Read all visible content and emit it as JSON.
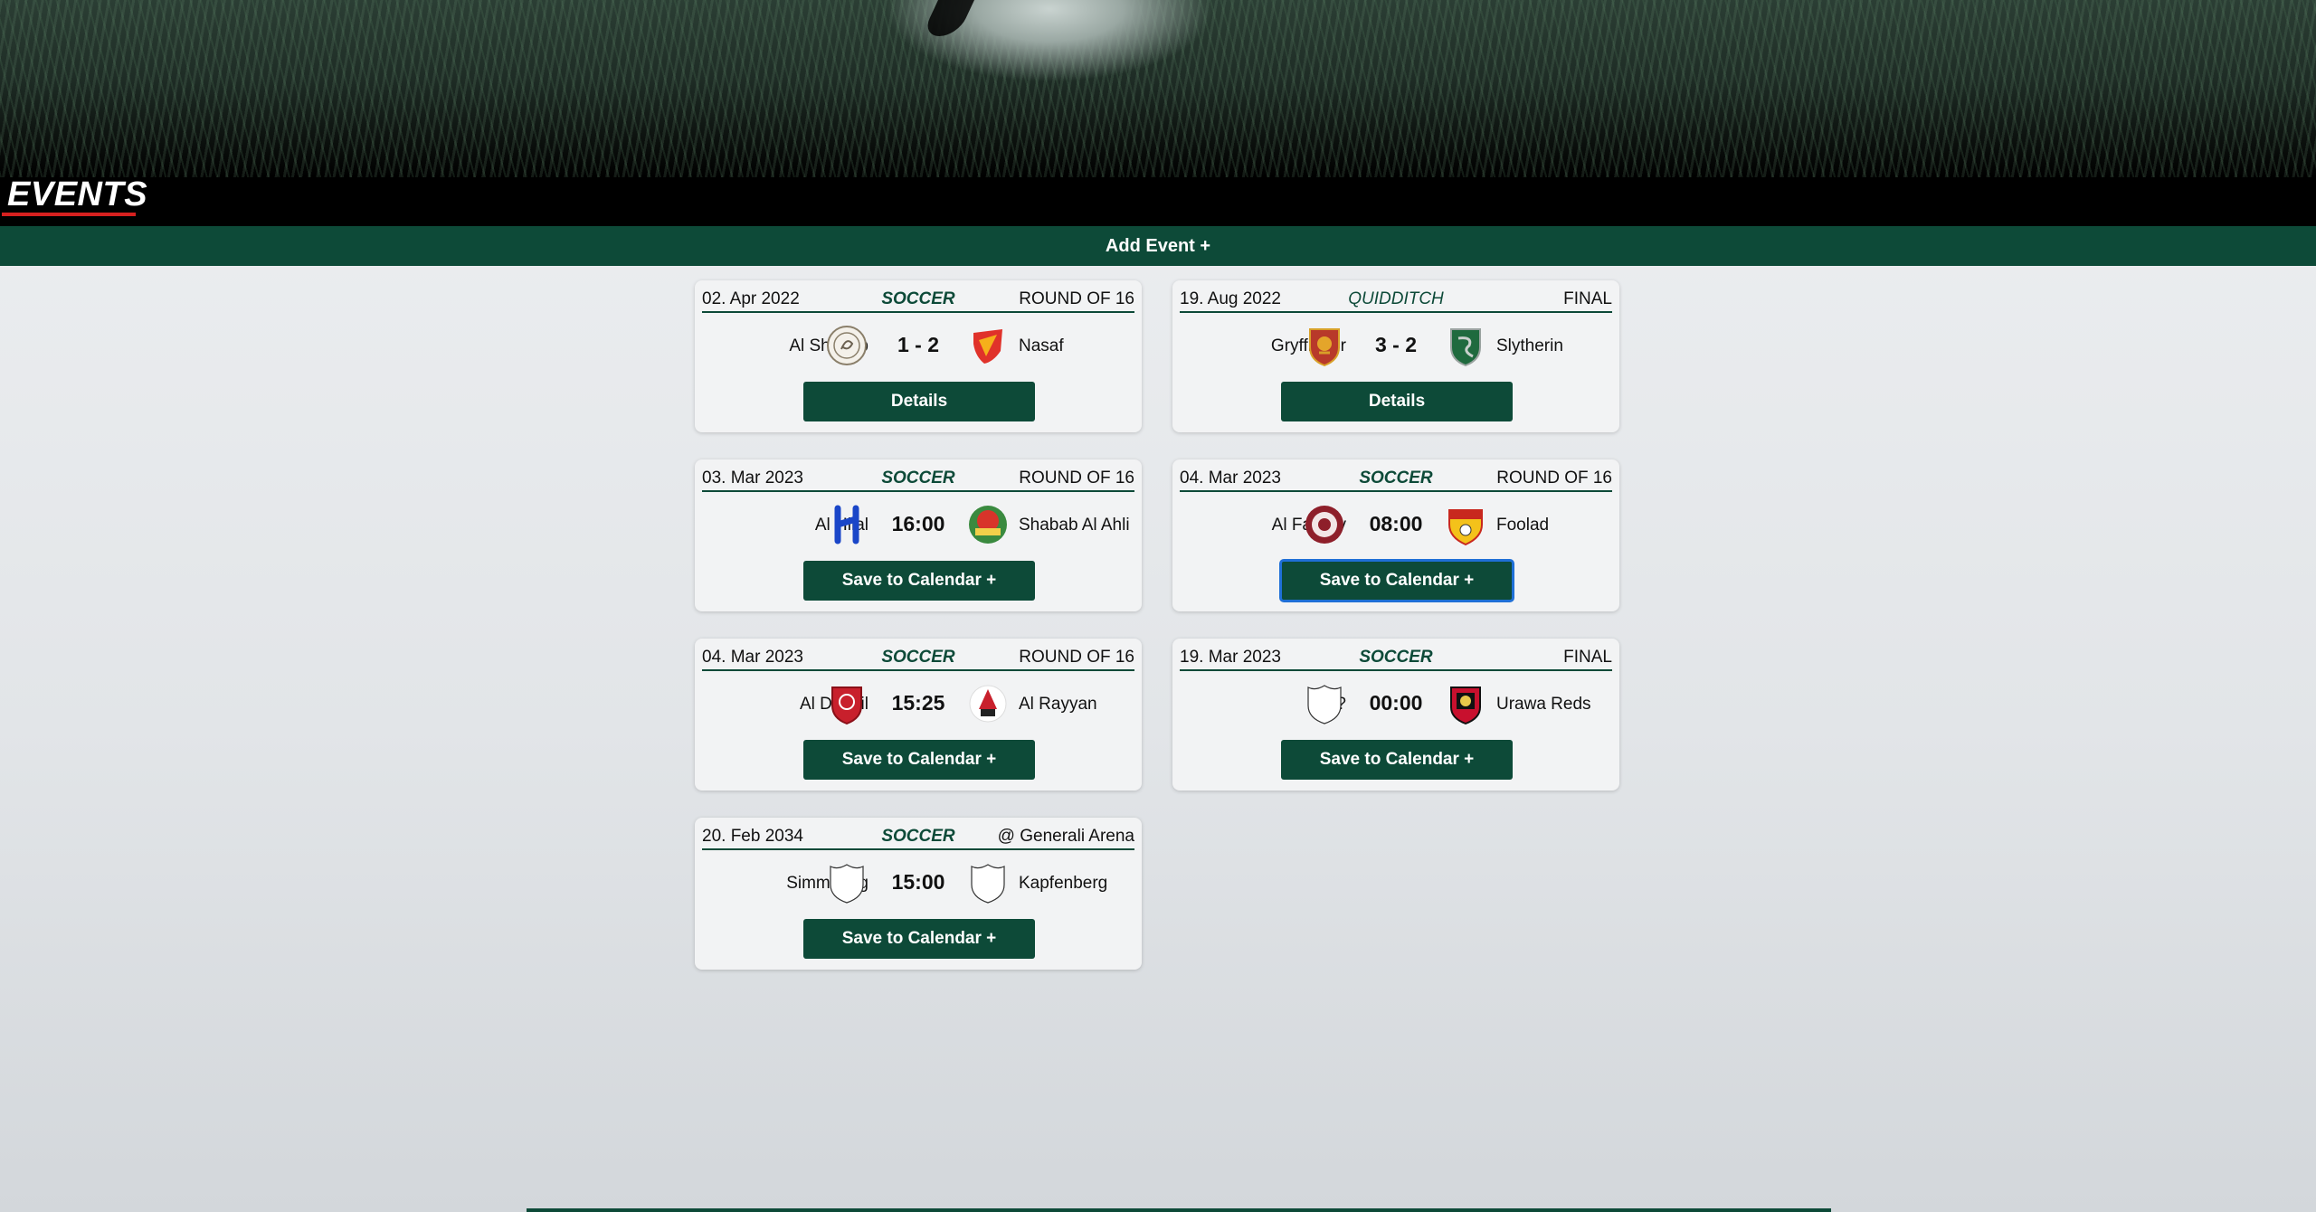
{
  "header": {
    "title": "EVENTS",
    "add_event_label": "Add Event +"
  },
  "events": [
    {
      "date": "02. Apr 2022",
      "sport": "SOCCER",
      "round": "ROUND OF 16",
      "home": "Al Shabab",
      "away": "Nasaf",
      "score": "1 - 2",
      "button": "Details",
      "home_logo": "al-shabab-logo",
      "away_logo": "nasaf-logo"
    },
    {
      "date": "19. Aug 2022",
      "sport": "QUIDDITCH",
      "round": "FINAL",
      "home": "Gryffindor",
      "away": "Slytherin",
      "score": "3 - 2",
      "button": "Details",
      "home_logo": "gryffindor-crest",
      "away_logo": "slytherin-crest"
    },
    {
      "date": "03. Mar 2023",
      "sport": "SOCCER",
      "round": "ROUND OF 16",
      "home": "Al Hilal",
      "away": "Shabab Al Ahli",
      "score": "16:00",
      "button": "Save to Calendar +",
      "home_logo": "al-hilal-logo",
      "away_logo": "shabab-al-ahli-logo"
    },
    {
      "date": "04. Mar 2023",
      "sport": "SOCCER",
      "round": "ROUND OF 16",
      "home": "Al Faisaly",
      "away": "Foolad",
      "score": "08:00",
      "button": "Save to Calendar +",
      "home_logo": "al-faisaly-logo",
      "away_logo": "foolad-logo"
    },
    {
      "date": "04. Mar 2023",
      "sport": "SOCCER",
      "round": "ROUND OF 16",
      "home": "Al Duhail",
      "away": "Al Rayyan",
      "score": "15:25",
      "button": "Save to Calendar +",
      "home_logo": "al-duhail-logo",
      "away_logo": "al-rayyan-logo"
    },
    {
      "date": "19. Mar 2023",
      "sport": "SOCCER",
      "round": "FINAL",
      "home": "?",
      "away": "Urawa Reds",
      "score": "00:00",
      "button": "Save to Calendar +",
      "home_logo": "blank-shield-icon",
      "away_logo": "urawa-reds-logo"
    },
    {
      "date": "20. Feb 2034",
      "sport": "SOCCER",
      "round": "@ Generali Arena",
      "home": "Simmering",
      "away": "Kapfenberg",
      "score": "15:00",
      "button": "Save to Calendar +",
      "home_logo": "blank-shield-icon",
      "away_logo": "blank-shield-icon"
    }
  ],
  "colors": {
    "primary": "#0d4a38",
    "accent_red": "#d6201f",
    "focus_ring": "#1f6fd6"
  }
}
